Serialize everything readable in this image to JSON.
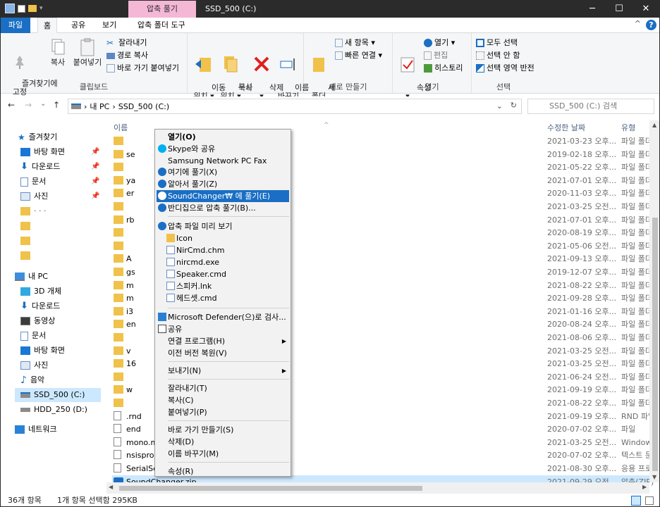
{
  "window": {
    "context_tab": "압축 풀기",
    "title": "SSD_500 (C:)",
    "minimize": "─",
    "maximize": "☐",
    "close": "✕"
  },
  "tabs": {
    "file": "파일",
    "home": "홈",
    "share": "공유",
    "view": "보기",
    "zip_tools": "압축 폴더 도구",
    "help": "?",
    "collapse": "^"
  },
  "ribbon": {
    "pin_quick": "즐겨찾기에\n고정",
    "copy": "복사",
    "paste": "붙여넣기",
    "cut": "잘라내기",
    "copy_path": "경로 복사",
    "paste_shortcut": "바로 가기 붙여넣기",
    "clipboard_label": "클립보드",
    "move_to": "이동\n위치 ▾",
    "copy_to": "복사\n위치 ▾",
    "delete": "삭제\n▾",
    "rename": "이름\n바꾸기",
    "organize_label": "구성",
    "new_folder": "새\n폴더",
    "new_item": "새 항목 ▾",
    "easy_access": "빠른 연결 ▾",
    "new_label": "새로 만들기",
    "properties": "속성\n▾",
    "open": "열기 ▾",
    "edit": "편집",
    "history": "히스토리",
    "open_label": "열기",
    "select_all": "모두 선택",
    "select_none": "선택 안 함",
    "invert_selection": "선택 영역 반전",
    "select_label": "선택"
  },
  "address": {
    "back": "←",
    "forward": "→",
    "recent": "⌄",
    "up": "↑",
    "crumbs": [
      "내 PC",
      "SSD_500 (C:)"
    ],
    "sep": "›",
    "dropdown": "⌄",
    "refresh": "↻"
  },
  "search": {
    "placeholder": "SSD_500 (C:) 검색"
  },
  "navpane": {
    "quick": "즐겨찾기",
    "desktop": "바탕 화면",
    "downloads": "다운로드",
    "documents": "문서",
    "pictures": "사진",
    "misc_dots": "·   ·   ·",
    "pc": "내 PC",
    "objects3d": "3D 개체",
    "pc_downloads": "다운로드",
    "videos": "동영상",
    "pc_documents": "문서",
    "pc_desktop": "바탕 화면",
    "pc_pictures": "사진",
    "music": "음악",
    "drive_c": "SSD_500 (C:)",
    "drive_d": "HDD_250 (D:)",
    "network": "네트워크",
    "pin_glyph": "📌"
  },
  "columns": {
    "name": "이름",
    "date": "수정한 날짜",
    "type": "유형",
    "sort_indicator": "^"
  },
  "files": [
    {
      "name": "",
      "date": "2021-03-23 오후...",
      "type": "파일 폴더"
    },
    {
      "name": "se",
      "date": "2019-02-18 오후...",
      "type": "파일 폴더"
    },
    {
      "name": "",
      "date": "2021-05-22 오후...",
      "type": "파일 폴더"
    },
    {
      "name": "ya",
      "date": "2021-07-01 오후...",
      "type": "파일 폴더"
    },
    {
      "name": "er",
      "date": "2020-11-03 오후...",
      "type": "파일 폴더"
    },
    {
      "name": "",
      "date": "2021-03-25 오전...",
      "type": "파일 폴더"
    },
    {
      "name": "rb",
      "date": "2021-07-01 오후...",
      "type": "파일 폴더"
    },
    {
      "name": "",
      "date": "2020-08-19 오후...",
      "type": "파일 폴더"
    },
    {
      "name": "",
      "date": "2021-05-06 오전...",
      "type": "파일 폴더"
    },
    {
      "name": "A",
      "date": "2021-09-13 오후...",
      "type": "파일 폴더"
    },
    {
      "name": "gs",
      "date": "2019-12-07 오후...",
      "type": "파일 폴더"
    },
    {
      "name": "m",
      "date": "2021-08-22 오후...",
      "type": "파일 폴더"
    },
    {
      "name": "m",
      "date": "2021-09-28 오후...",
      "type": "파일 폴더"
    },
    {
      "name": "i3",
      "date": "2021-01-16 오후...",
      "type": "파일 폴더"
    },
    {
      "name": "en",
      "date": "2020-08-24 오후...",
      "type": "파일 폴더"
    },
    {
      "name": "",
      "date": "2021-08-06 오후...",
      "type": "파일 폴더"
    },
    {
      "name": "v",
      "date": "2021-03-25 오전...",
      "type": "파일 폴더"
    },
    {
      "name": "16",
      "date": "2021-03-25 오전...",
      "type": "파일 폴더"
    },
    {
      "name": "",
      "date": "2021-06-24 오전...",
      "type": "파일 폴더"
    },
    {
      "name": "w",
      "date": "2021-09-19 오후...",
      "type": "파일 폴더"
    },
    {
      "name": "",
      "date": "2021-08-22 오후...",
      "type": "파일 폴더"
    },
    {
      "name": ".rnd",
      "date": "2021-09-19 오후...",
      "type": "RND 파일"
    },
    {
      "name": "end",
      "date": "2020-07-02 오후...",
      "type": "파일"
    },
    {
      "name": "mono.m",
      "date": "2021-03-25 오전...",
      "type": "Windows"
    },
    {
      "name": "nsisprom",
      "date": "2020-07-02 오후...",
      "type": "텍스트 문서"
    },
    {
      "name": "SerialSer",
      "date": "2021-08-30 오후...",
      "type": "응용 프로그램"
    },
    {
      "name": "SoundChanger.zip",
      "date": "2021-09-29 오전...",
      "type": "압축(ZIP)"
    }
  ],
  "context_menu": {
    "open": "열기(O)",
    "skype": "Skype와 공유",
    "fax": "Samsung Network PC Fax",
    "extract_here": "여기에 풀기(X)",
    "extract_smart": "알아서 풀기(Z)",
    "extract_to": "SoundChanger₩ 에 풀기(E)",
    "extract_bandizip": "반디집으로 압축 풀기(B)...",
    "preview": "압축 파일 미리 보기",
    "sub_icon": "Icon",
    "sub_nircmd_chm": "NirCmd.chm",
    "sub_nircmd_exe": "nircmd.exe",
    "sub_speaker": "Speaker.cmd",
    "sub_speaker_lnk": "스피커.lnk",
    "sub_headset": "헤드셋.cmd",
    "defender": "Microsoft Defender(으)로 검사...",
    "share": "공유",
    "open_with": "연결 프로그램(H)",
    "restore": "이전 버전 복원(V)",
    "send_to": "보내기(N)",
    "cut": "잘라내기(T)",
    "copy": "복사(C)",
    "paste": "붙여넣기(P)",
    "create_shortcut": "바로 가기 만들기(S)",
    "delete": "삭제(D)",
    "rename": "이름 바꾸기(M)",
    "properties": "속성(R)",
    "arrow": "▶"
  },
  "status": {
    "count": "36개 항목",
    "selected": "1개 항목 선택함 295KB"
  },
  "colors": {
    "accent": "#1a6fc4",
    "folder": "#f0c24b",
    "selection": "#cce8ff",
    "titlebar": "#2b2b2b",
    "context_tab": "#f4b8d6"
  }
}
